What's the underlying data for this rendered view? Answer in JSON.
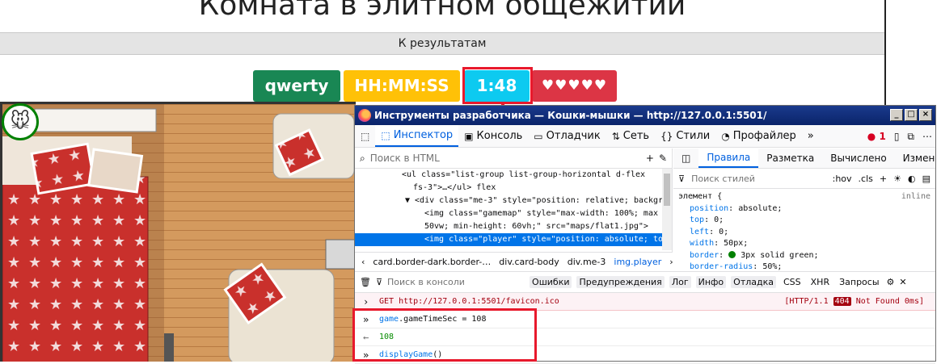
{
  "page": {
    "title": "Комната в элитном общежитии",
    "results_link": "К результатам",
    "badges": {
      "player_name": "qwerty",
      "time_format": "HH:MM:SS",
      "timer": "1:48",
      "lives": "♥♥♥♥♥"
    },
    "map_alt": "maps/flat1.jpg"
  },
  "devtools": {
    "window_title": "Инструменты разработчика — Кошки-мышки — http://127.0.0.1:5501/",
    "tabs": [
      "Инспектор",
      "Консоль",
      "Отладчик",
      "Сеть",
      "Стили",
      "Профайлер"
    ],
    "error_count": "1",
    "html_search_placeholder": "Поиск в HTML",
    "tree": [
      {
        "text": "<ul class=\"list-group list-group-horizontal d-flex"
      },
      {
        "text": "fs-3\">…</ul> flex"
      },
      {
        "text": "▼ <div class=\"me-3\" style=\"position: relative; backgr"
      },
      {
        "text": "<img class=\"gamemap\" style=\"max-width: 100%; max"
      },
      {
        "text": "50vw; min-height: 60vh;\" src=\"maps/flat1.jpg\">"
      },
      {
        "text": "<img class=\"player\" style=\"position: absolute; to"
      }
    ],
    "breadcrumbs": [
      "card.border-dark.border-…",
      "div.card-body",
      "div.me-3",
      "img.player"
    ],
    "rules_tabs": [
      "Правила",
      "Разметка",
      "Вычислено",
      "Изменения"
    ],
    "styles_filter_placeholder": "Поиск стилей",
    "hov_label": ":hov",
    "cls_label": ".cls",
    "element_rule": "элемент {",
    "inline_label": "inline",
    "css": [
      {
        "prop": "position",
        "value": "absolute;"
      },
      {
        "prop": "top",
        "value": "0;"
      },
      {
        "prop": "left",
        "value": "0;"
      },
      {
        "prop": "width",
        "value": "50px;"
      },
      {
        "prop": "border",
        "value": "3px solid green;"
      },
      {
        "prop": "border-radius",
        "value": "50%;"
      }
    ],
    "console_filter_placeholder": "Поиск в консоли",
    "console_filters": [
      "Ошибки",
      "Предупреждения",
      "Лог",
      "Инфо",
      "Отладка",
      "CSS",
      "XHR",
      "Запросы"
    ],
    "console": {
      "error_text": "GET http://127.0.0.1:5501/favicon.ico",
      "error_status_pre": "[HTTP/1.1 ",
      "error_code": "404",
      "error_status_post": " Not Found 0ms]",
      "cmd1_obj": "game",
      "cmd1_rest": ".gameTimeSec = 108",
      "result1": "108",
      "cmd2_fn": "displayGame",
      "cmd2_rest": "()"
    }
  },
  "colors": {
    "annotation_red": "#e8192c",
    "badge_green": "#198754",
    "badge_yellow": "#ffc107",
    "badge_cyan": "#0dcaf0",
    "badge_red": "#dc3545",
    "accent_blue": "#0060df"
  }
}
